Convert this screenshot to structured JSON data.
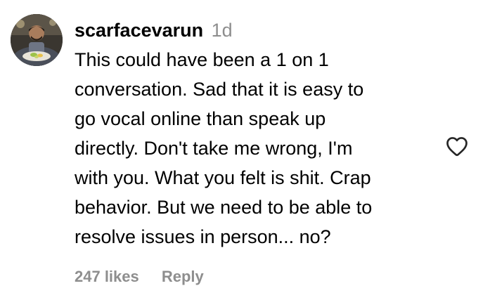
{
  "comment": {
    "username": "scarfacevarun",
    "time_ago": "1d",
    "text_lines": [
      "This could have been a 1 on 1",
      "conversation. Sad that it is easy to",
      "go vocal online than speak up",
      "directly. Don't take me wrong, I'm",
      "with you. What you felt is shit. Crap",
      "behavior. But we need to be able to",
      "resolve issues in person... no?"
    ],
    "likes": "247 likes",
    "reply_label": "Reply"
  },
  "icons": {
    "like": "heart-outline-icon",
    "avatar": "user-profile-photo"
  },
  "colors": {
    "text": "#000000",
    "muted": "#8e8e8e",
    "icon": "#262626",
    "background": "#ffffff"
  }
}
